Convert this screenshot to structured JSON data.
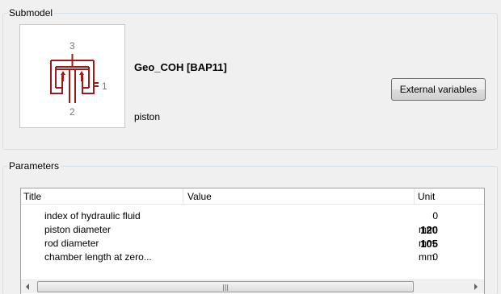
{
  "submodel": {
    "group_title": "Submodel",
    "name": "Geo_COH [BAP11]",
    "description": "piston",
    "external_variables_label": "External variables",
    "icon": {
      "name": "hydraulic-piston-icon",
      "port_labels": [
        "3",
        "1",
        "2"
      ],
      "color": "#9b1c1c"
    }
  },
  "parameters": {
    "group_title": "Parameters",
    "columns": [
      "Title",
      "Value",
      "Unit"
    ],
    "rows": [
      {
        "title": "index of hydraulic fluid",
        "value": "0",
        "unit": "",
        "bold": false
      },
      {
        "title": "piston diameter",
        "value": "120",
        "unit": "mm",
        "bold": true
      },
      {
        "title": "rod diameter",
        "value": "105",
        "unit": "mm",
        "bold": true
      },
      {
        "title": "chamber length at zero...",
        "value": "0",
        "unit": "mm",
        "bold": false
      }
    ]
  }
}
